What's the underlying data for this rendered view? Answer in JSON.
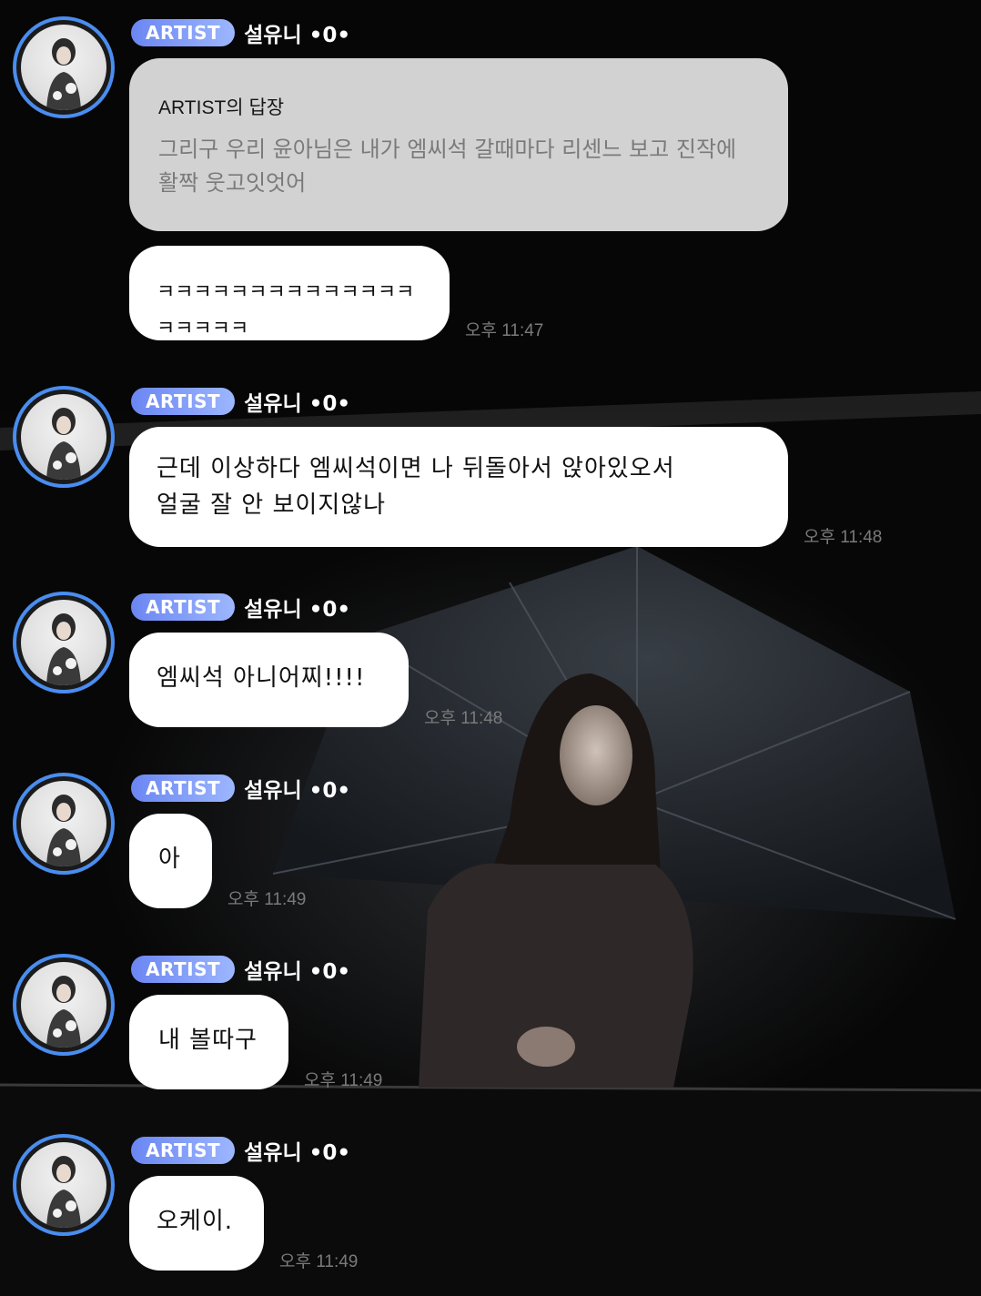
{
  "colors": {
    "badge_start": "#6b86f2",
    "badge_end": "#9cb6ff",
    "avatar_ring": "#4a8df0",
    "bubble": "#ffffff",
    "reply_bubble": "#d2d2d2",
    "time": "#7a7a7a"
  },
  "messages": [
    {
      "badge": "ARTIST",
      "nickname": "설유니 •0•",
      "reply_title": "ARTIST의 답장",
      "reply_text": "그리구 우리 윤아님은 내가 엠씨석 갈때마다 리센느 보고 진작에\n활짝 웃고잇엇어",
      "text": "ㅋㅋㅋㅋㅋㅋㅋㅋㅋㅋㅋㅋㅋㅋㅋㅋㅋㅋㅋ",
      "time": "오후 11:47"
    },
    {
      "badge": "ARTIST",
      "nickname": "설유니 •0•",
      "text": "근데 이상하다 엠씨석이면 나 뒤돌아서 앉아있오서\n얼굴 잘 안 보이지않나",
      "time": "오후 11:48"
    },
    {
      "badge": "ARTIST",
      "nickname": "설유니 •0•",
      "text": "엠씨석 아니어찌!!!!",
      "time": "오후 11:48"
    },
    {
      "badge": "ARTIST",
      "nickname": "설유니 •0•",
      "text": "아",
      "time": "오후 11:49"
    },
    {
      "badge": "ARTIST",
      "nickname": "설유니 •0•",
      "text": "내 볼따구",
      "time": "오후 11:49"
    },
    {
      "badge": "ARTIST",
      "nickname": "설유니 •0•",
      "text": "오케이.",
      "time": "오후 11:49"
    }
  ]
}
